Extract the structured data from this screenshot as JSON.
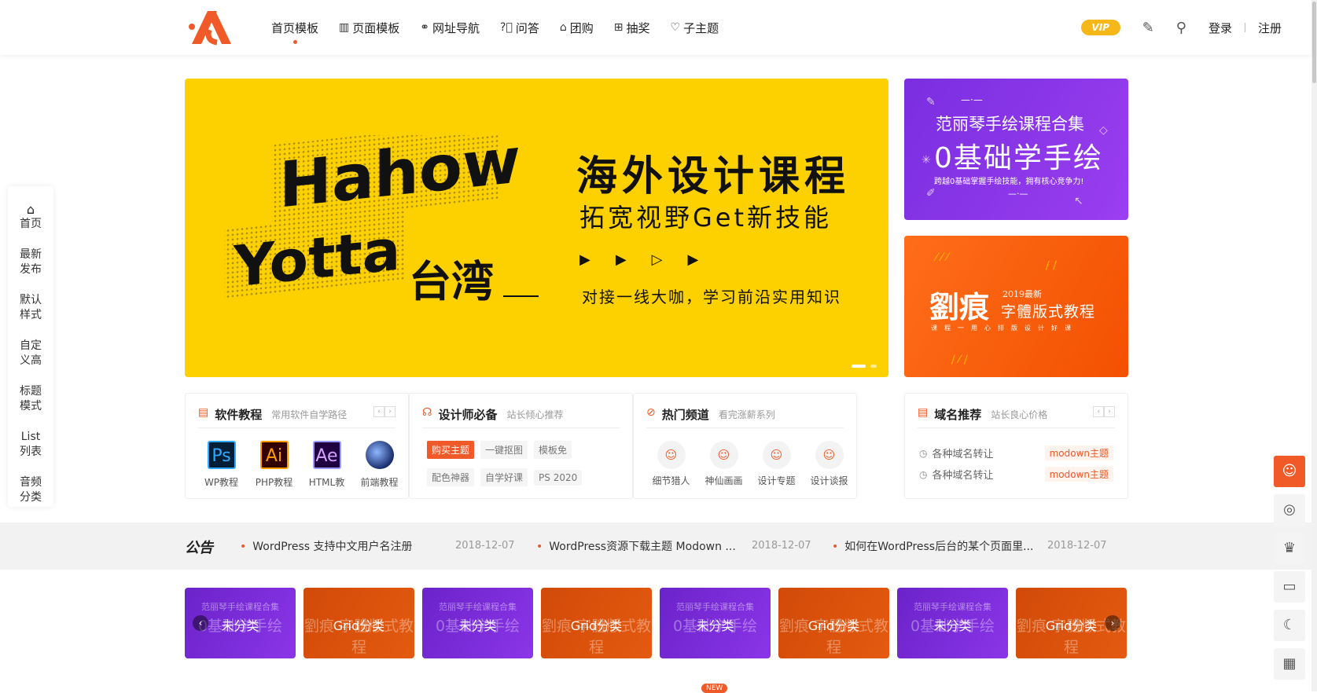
{
  "colors": {
    "accent": "#f05a28",
    "banner_yellow": "#fdd000",
    "purple": "#8a35eb",
    "orange": "#ff5a10",
    "vip": "#f6b719"
  },
  "nav": {
    "items": [
      {
        "label": "首页模板",
        "icon": "none",
        "active": true
      },
      {
        "label": "页面模板",
        "icon": "book-icon"
      },
      {
        "label": "网址导航",
        "icon": "link-icon"
      },
      {
        "label": "问答",
        "icon": "question-icon"
      },
      {
        "label": "团购",
        "icon": "bag-icon"
      },
      {
        "label": "抽奖",
        "icon": "gamepad-icon"
      },
      {
        "label": "子主题",
        "icon": "heart-icon"
      }
    ]
  },
  "header": {
    "vip": "VIP",
    "login": "登录",
    "register": "注册"
  },
  "sidenav": [
    {
      "label": "首页"
    },
    {
      "line1": "最新",
      "line2": "发布"
    },
    {
      "line1": "默认",
      "line2": "样式"
    },
    {
      "line1": "自定",
      "line2": "义高"
    },
    {
      "line1": "标题",
      "line2": "模式"
    },
    {
      "line1": "List",
      "line2": "列表"
    },
    {
      "line1": "音频",
      "line2": "分类"
    }
  ],
  "banner": {
    "title": "海外设计课程",
    "subtitle": "拓宽视野Get新技能",
    "arrows": "▶▶▷▶",
    "desc": "对接一线大咖，学习前沿实用知识",
    "art_line1": "Hahow",
    "art_line2": "Yotta",
    "art_line3": "台湾"
  },
  "side_cards": {
    "purple": {
      "title": "范丽琴手绘课程合集",
      "big": "0基础学手绘",
      "desc": "跨越0基础掌握手绘技能，拥有核心竞争力!",
      "dash": "—·—"
    },
    "orange": {
      "big": "劉痕",
      "small": "2019最新",
      "title": "字體版式教程",
      "tag": "课程一用心排版设计好课"
    }
  },
  "boxes": {
    "software": {
      "title": "软件教程",
      "subtitle": "常用软件自学路径",
      "apps": [
        {
          "icon": "Ps",
          "label": "WP教程"
        },
        {
          "icon": "Ai",
          "label": "PHP教程"
        },
        {
          "icon": "Ae",
          "label": "HTML教"
        },
        {
          "icon": "C4D",
          "label": "前端教程"
        }
      ]
    },
    "designer": {
      "title": "设计师必备",
      "subtitle": "站长倾心推荐",
      "tags": [
        "购买主题",
        "一键抠图",
        "模板免",
        "配色神器",
        "自学好课",
        "PS 2020"
      ]
    },
    "hot": {
      "title": "热门频道",
      "subtitle": "看完涨薪系列",
      "channels": [
        "细节猎人",
        "神仙画画",
        "设计专题",
        "设计谈报"
      ]
    },
    "domain": {
      "title": "域名推荐",
      "subtitle": "站长良心价格",
      "rows": [
        {
          "label": "各种域名转让",
          "tag": "modown主题"
        },
        {
          "label": "各种域名转让",
          "tag": "modown主题"
        }
      ]
    }
  },
  "notice": {
    "label": "公告",
    "items": [
      {
        "text": "WordPress 支持中文用户名注册",
        "date": "2018-12-07"
      },
      {
        "text": "WordPress资源下载主题 Modown ...",
        "date": "2018-12-07"
      },
      {
        "text": "如何在WordPress后台的某个页面里...",
        "date": "2018-12-07"
      }
    ]
  },
  "grid": {
    "cards": [
      {
        "label": "未分类",
        "bg1": "范丽琴手绘课程合集",
        "bg2": "0基础学手绘"
      },
      {
        "label": "Grid分类",
        "bg1": "",
        "bg2": "劉痕 字體版式教程"
      },
      {
        "label": "未分类",
        "bg1": "范丽琴手绘课程合集",
        "bg2": "0基础学手绘"
      },
      {
        "label": "Grid分类",
        "bg1": "",
        "bg2": "劉痕 字體版式教程"
      },
      {
        "label": "未分类",
        "bg1": "范丽琴手绘课程合集",
        "bg2": "0基础学手绘"
      },
      {
        "label": "Grid分类",
        "bg1": "",
        "bg2": "劉痕 字體版式教程"
      },
      {
        "label": "未分类",
        "bg1": "范丽琴手绘课程合集",
        "bg2": "0基础学手绘"
      },
      {
        "label": "Grid分类",
        "bg1": "",
        "bg2": "劉痕 字體版式教程"
      }
    ],
    "new_badge": "NEW"
  }
}
